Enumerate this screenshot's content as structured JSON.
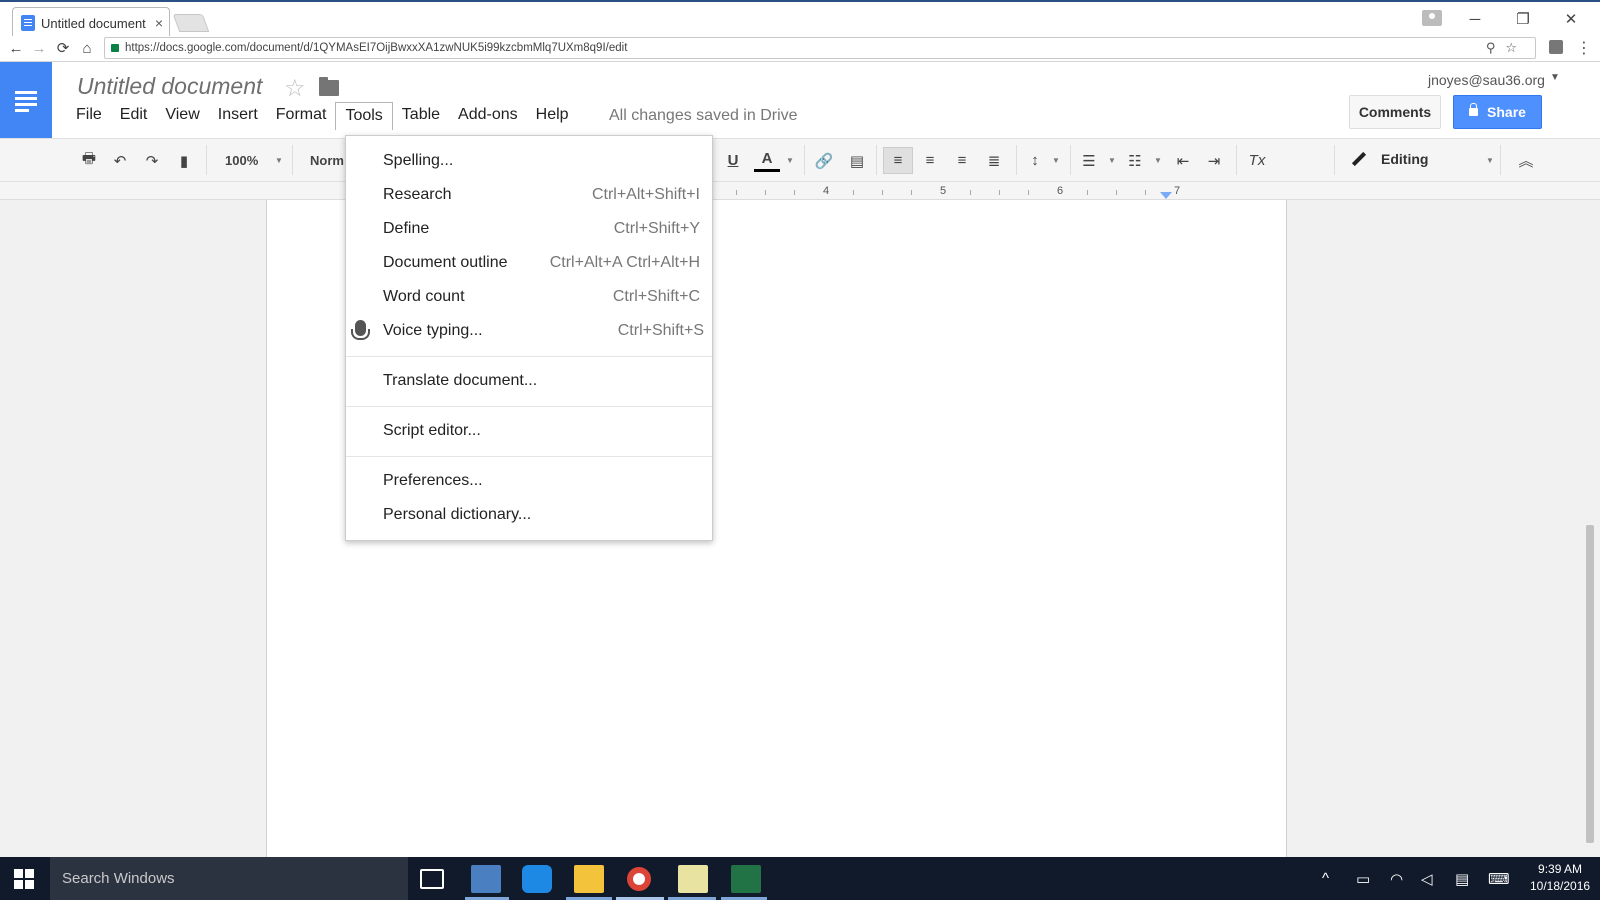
{
  "browser": {
    "tab_title": "Untitled document",
    "tab_close": "×",
    "url": "https://docs.google.com/document/d/1QYMAsEI7OijBwxxXA1zwNUK5i99kzcbmMlq7UXm8q9I/edit",
    "window_controls": {
      "minimize": "─",
      "restore": "❐",
      "close": "✕"
    },
    "nav": {
      "back": "←",
      "forward": "→",
      "reload": "⟳",
      "home": "⌂"
    },
    "omni_icons": "⚲☆",
    "menu_dots": "⋮"
  },
  "docs": {
    "title": "Untitled document",
    "star": "☆",
    "menus": [
      "File",
      "Edit",
      "View",
      "Insert",
      "Format",
      "Tools",
      "Table",
      "Add-ons",
      "Help"
    ],
    "active_menu": "Tools",
    "save_status": "All changes saved in Drive",
    "account": "jnoyes@sau36.org",
    "comments_label": "Comments",
    "share_label": "Share",
    "accent_color": "#4285f4"
  },
  "toolbar": {
    "zoom": "100%",
    "style": "Norm",
    "underline": "U",
    "text_color": "A",
    "clear_format": "Tx",
    "mode": "Editing",
    "collapse": "︽"
  },
  "ruler": {
    "numbers": [
      "4",
      "5",
      "6",
      "7"
    ]
  },
  "tools_menu": {
    "groups": [
      [
        {
          "label": "Spelling...",
          "shortcut": ""
        },
        {
          "label": "Research",
          "shortcut": "Ctrl+Alt+Shift+I"
        },
        {
          "label": "Define",
          "shortcut": "Ctrl+Shift+Y"
        },
        {
          "label": "Document outline",
          "shortcut": "Ctrl+Alt+A Ctrl+Alt+H"
        },
        {
          "label": "Word count",
          "shortcut": "Ctrl+Shift+C"
        },
        {
          "label": "Voice typing...",
          "shortcut": "Ctrl+Shift+S",
          "icon": "microphone-icon"
        }
      ],
      [
        {
          "label": "Translate document...",
          "shortcut": ""
        }
      ],
      [
        {
          "label": "Script editor...",
          "shortcut": ""
        }
      ],
      [
        {
          "label": "Preferences...",
          "shortcut": ""
        },
        {
          "label": "Personal dictionary...",
          "shortcut": ""
        }
      ]
    ]
  },
  "taskbar": {
    "search_placeholder": "Search Windows",
    "time": "9:39 AM",
    "date": "10/18/2016",
    "tray_chevron": "^"
  }
}
